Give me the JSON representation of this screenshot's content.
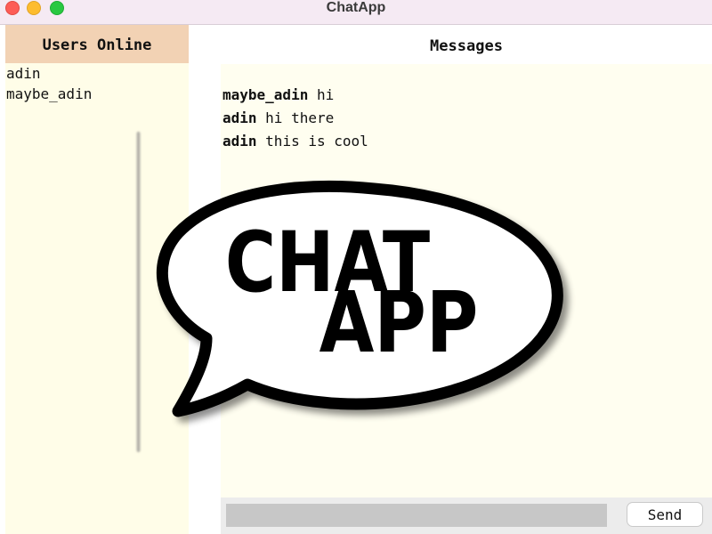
{
  "window": {
    "title": "ChatApp"
  },
  "users_panel": {
    "header": "Users Online",
    "users": [
      "adin",
      "maybe_adin"
    ]
  },
  "messages_panel": {
    "title": "Messages",
    "messages": [
      {
        "author": "maybe_adin",
        "text": "hi"
      },
      {
        "author": "adin",
        "text": "hi there"
      },
      {
        "author": "adin",
        "text": "this is cool"
      }
    ]
  },
  "compose": {
    "input_value": "",
    "send_label": "Send"
  },
  "logo": {
    "line1": "CHAT",
    "line2": "APP"
  },
  "colors": {
    "users_header_bg": "#f2d2b4",
    "panel_bg": "#fffde8",
    "titlebar_bg": "#f5eaf3"
  }
}
